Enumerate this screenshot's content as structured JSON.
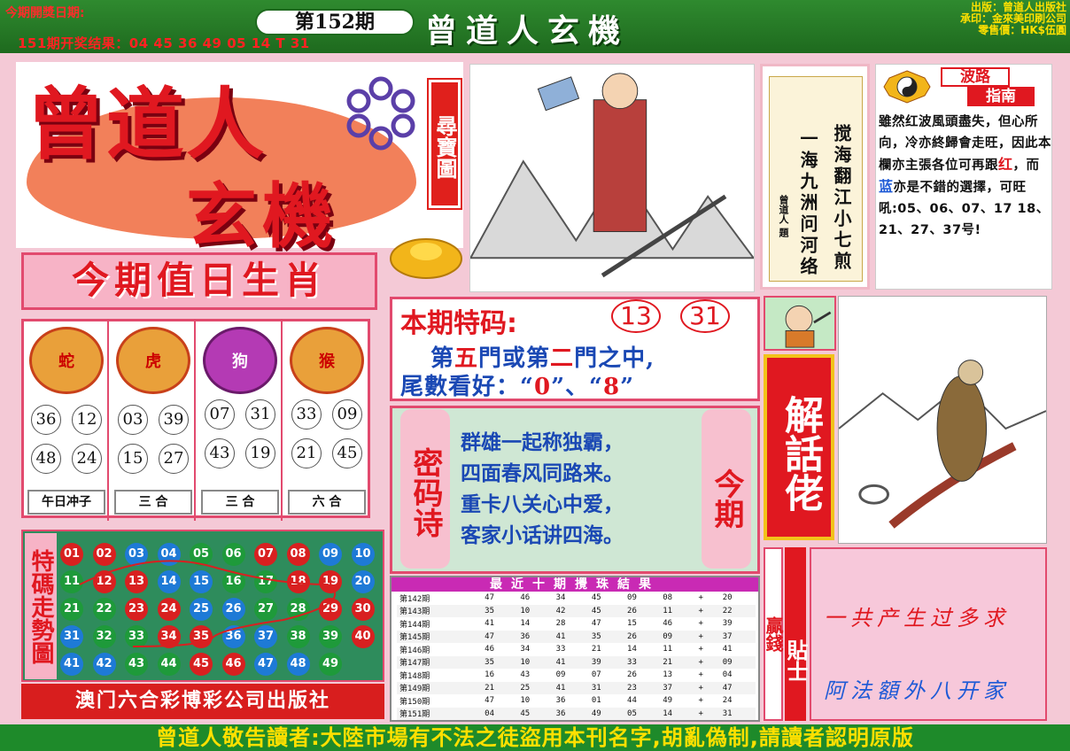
{
  "header": {
    "draw_date_label": "今期開獎日期:",
    "last_result": "151期开奖结果：04 45 36 49 05 14 T 31",
    "issue": "第152期",
    "brand": "曾道人玄機",
    "publisher": [
      "出版：曾道人出版社",
      "承印：金來美印刷公司",
      "零售價：HK$伍圓"
    ]
  },
  "logo": {
    "main": "曾道人",
    "sub": "玄機",
    "tag": "尋寶圖"
  },
  "zodiac": {
    "banner": "今期值日生肖",
    "columns": [
      {
        "name": "蛇",
        "nums": [
          "36",
          "12",
          "48",
          "24"
        ],
        "label": "午日冲子"
      },
      {
        "name": "虎",
        "nums": [
          "03",
          "39",
          "15",
          "27"
        ],
        "label": "三 合"
      },
      {
        "name": "狗",
        "nums": [
          "07",
          "31",
          "43",
          "19"
        ],
        "label": "三 合"
      },
      {
        "name": "猴",
        "nums": [
          "33",
          "09",
          "21",
          "45"
        ],
        "label": "六 合"
      }
    ]
  },
  "trend": {
    "title": "特碼走勢圖",
    "rows": [
      [
        [
          "01",
          "r"
        ],
        [
          "02",
          "r"
        ],
        [
          "03",
          "b"
        ],
        [
          "04",
          "b"
        ],
        [
          "05",
          "g"
        ],
        [
          "06",
          "g"
        ],
        [
          "07",
          "r"
        ],
        [
          "08",
          "r"
        ],
        [
          "09",
          "b"
        ],
        [
          "10",
          "b"
        ]
      ],
      [
        [
          "11",
          "g"
        ],
        [
          "12",
          "r"
        ],
        [
          "13",
          "r"
        ],
        [
          "14",
          "b"
        ],
        [
          "15",
          "b"
        ],
        [
          "16",
          "g"
        ],
        [
          "17",
          "g"
        ],
        [
          "18",
          "r"
        ],
        [
          "19",
          "r"
        ],
        [
          "20",
          "b"
        ]
      ],
      [
        [
          "21",
          "g"
        ],
        [
          "22",
          "g"
        ],
        [
          "23",
          "r"
        ],
        [
          "24",
          "r"
        ],
        [
          "25",
          "b"
        ],
        [
          "26",
          "b"
        ],
        [
          "27",
          "g"
        ],
        [
          "28",
          "g"
        ],
        [
          "29",
          "r"
        ],
        [
          "30",
          "r"
        ]
      ],
      [
        [
          "31",
          "b"
        ],
        [
          "32",
          "g"
        ],
        [
          "33",
          "g"
        ],
        [
          "34",
          "r"
        ],
        [
          "35",
          "r"
        ],
        [
          "36",
          "b"
        ],
        [
          "37",
          "b"
        ],
        [
          "38",
          "g"
        ],
        [
          "39",
          "g"
        ],
        [
          "40",
          "r"
        ]
      ],
      [
        [
          "41",
          "b"
        ],
        [
          "42",
          "b"
        ],
        [
          "43",
          "g"
        ],
        [
          "44",
          "g"
        ],
        [
          "45",
          "r"
        ],
        [
          "46",
          "r"
        ],
        [
          "47",
          "b"
        ],
        [
          "48",
          "b"
        ],
        [
          "49",
          "g"
        ]
      ]
    ]
  },
  "macau_footer": "澳门六合彩博彩公司出版社",
  "poem_card": {
    "col1": "搅海翻江小七煎",
    "col2": "一海九洲问河络",
    "author": "曾道人 題"
  },
  "wave": {
    "title1": "波路",
    "title2": "指南",
    "text_a": "雖然红波風頭盡失，但心所向，冷亦終歸會走旺，因此本欄亦主張各位可再跟",
    "red": "红",
    "text_b": "，而",
    "blue": "蓝",
    "text_c": "亦是不錯的選擇，可旺吼:05、06、07、17 18、21、27、37号!"
  },
  "special": {
    "label": "本期特码:",
    "nums": [
      "13",
      "31"
    ],
    "line1_a": "第",
    "line1_h1": "五",
    "line1_b": "門或第",
    "line1_h2": "二",
    "line1_c": "門之中,",
    "line2_a": "尾數看好：“",
    "line2_h1": "0",
    "line2_b": "”、“",
    "line2_h2": "8",
    "line2_c": "”"
  },
  "code_poem": {
    "tag": "密码诗",
    "right_tag": "今期",
    "lines": [
      "群雄一起称独霸，",
      "四面春风同路来。",
      "重卡八关心中爱，",
      "客家小话讲四海。"
    ]
  },
  "results": {
    "title": "最近十期攪珠結果",
    "rows": [
      [
        "第142期",
        "47",
        "46",
        "34",
        "45",
        "09",
        "08",
        "+",
        "20"
      ],
      [
        "第143期",
        "35",
        "10",
        "42",
        "45",
        "26",
        "11",
        "+",
        "22"
      ],
      [
        "第144期",
        "41",
        "14",
        "28",
        "47",
        "15",
        "46",
        "+",
        "39"
      ],
      [
        "第145期",
        "47",
        "36",
        "41",
        "35",
        "26",
        "09",
        "+",
        "37"
      ],
      [
        "第146期",
        "46",
        "34",
        "33",
        "21",
        "14",
        "11",
        "+",
        "41"
      ],
      [
        "第147期",
        "35",
        "10",
        "41",
        "39",
        "33",
        "21",
        "+",
        "09"
      ],
      [
        "第148期",
        "16",
        "43",
        "09",
        "07",
        "26",
        "13",
        "+",
        "04"
      ],
      [
        "第149期",
        "21",
        "25",
        "41",
        "31",
        "23",
        "37",
        "+",
        "47"
      ],
      [
        "第150期",
        "47",
        "10",
        "36",
        "01",
        "44",
        "49",
        "+",
        "24"
      ],
      [
        "第151期",
        "04",
        "45",
        "36",
        "49",
        "05",
        "14",
        "+",
        "31"
      ]
    ]
  },
  "decode": {
    "banner": "解話佬"
  },
  "tips": {
    "left_tag": "贏錢",
    "tag": "貼士",
    "line1": "一共产生过多求",
    "line2": "阿法額外八开家"
  },
  "bottom_bar": "曾道人敬告讀者:大陸市場有不法之徒盜用本刊名字,胡亂偽制,請讀者認明原版",
  "colors": {
    "red": "#e01820",
    "green": "#1e8a2a",
    "blue": "#1a48b4",
    "pink": "#f7b3c6"
  }
}
